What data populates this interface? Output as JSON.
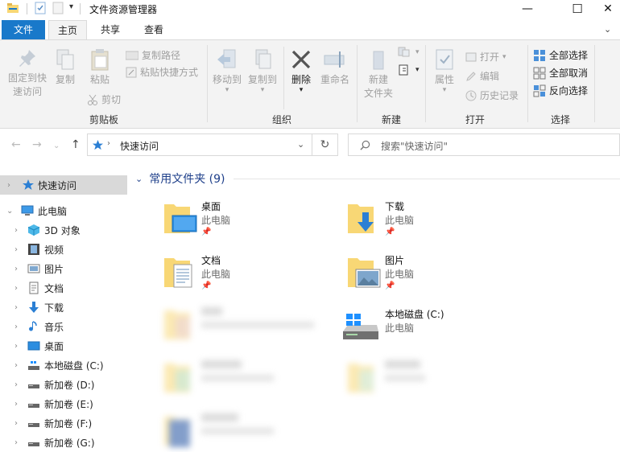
{
  "window": {
    "title": "文件资源管理器",
    "controls": {
      "minimize": "—",
      "maximize": "☐",
      "close": "✕"
    }
  },
  "tabs": [
    {
      "label": "文件"
    },
    {
      "label": "主页"
    },
    {
      "label": "共享"
    },
    {
      "label": "查看"
    }
  ],
  "ribbon": {
    "clipboard": {
      "pin_line1": "固定到快",
      "pin_line2": "速访问",
      "copy": "复制",
      "paste": "粘贴",
      "copy_path": "复制路径",
      "paste_shortcut": "粘贴快捷方式",
      "cut": "剪切",
      "group": "剪贴板"
    },
    "organize": {
      "move_to": "移动到",
      "copy_to": "复制到",
      "delete": "删除",
      "rename": "重命名",
      "group": "组织"
    },
    "new": {
      "new_folder_line1": "新建",
      "new_folder_line2": "文件夹",
      "group": "新建"
    },
    "open": {
      "properties": "属性",
      "open": "打开",
      "edit": "编辑",
      "history": "历史记录",
      "group": "打开"
    },
    "select": {
      "select_all": "全部选择",
      "select_none": "全部取消",
      "invert": "反向选择",
      "group": "选择"
    }
  },
  "address": {
    "path": "快速访问",
    "search_placeholder": "搜索\"快速访问\""
  },
  "nav": [
    {
      "label": "快速访问"
    },
    {
      "label": "此电脑"
    },
    {
      "label": "3D 对象"
    },
    {
      "label": "视频"
    },
    {
      "label": "图片"
    },
    {
      "label": "文档"
    },
    {
      "label": "下载"
    },
    {
      "label": "音乐"
    },
    {
      "label": "桌面"
    },
    {
      "label": "本地磁盘 (C:)"
    },
    {
      "label": "新加卷 (D:)"
    },
    {
      "label": "新加卷 (E:)"
    },
    {
      "label": "新加卷 (F:)"
    },
    {
      "label": "新加卷 (G:)"
    }
  ],
  "content": {
    "section_title": "常用文件夹 (9)",
    "tiles": [
      {
        "name": "桌面",
        "sub": "此电脑"
      },
      {
        "name": "下载",
        "sub": "此电脑"
      },
      {
        "name": "文档",
        "sub": "此电脑"
      },
      {
        "name": "图片",
        "sub": "此电脑"
      },
      {
        "name": "本地磁盘 (C:)",
        "sub": "此电脑"
      }
    ]
  },
  "colors": {
    "file_tab": "#1979ca",
    "folder": "#f8d775",
    "accent_blue": "#1e73c8"
  }
}
